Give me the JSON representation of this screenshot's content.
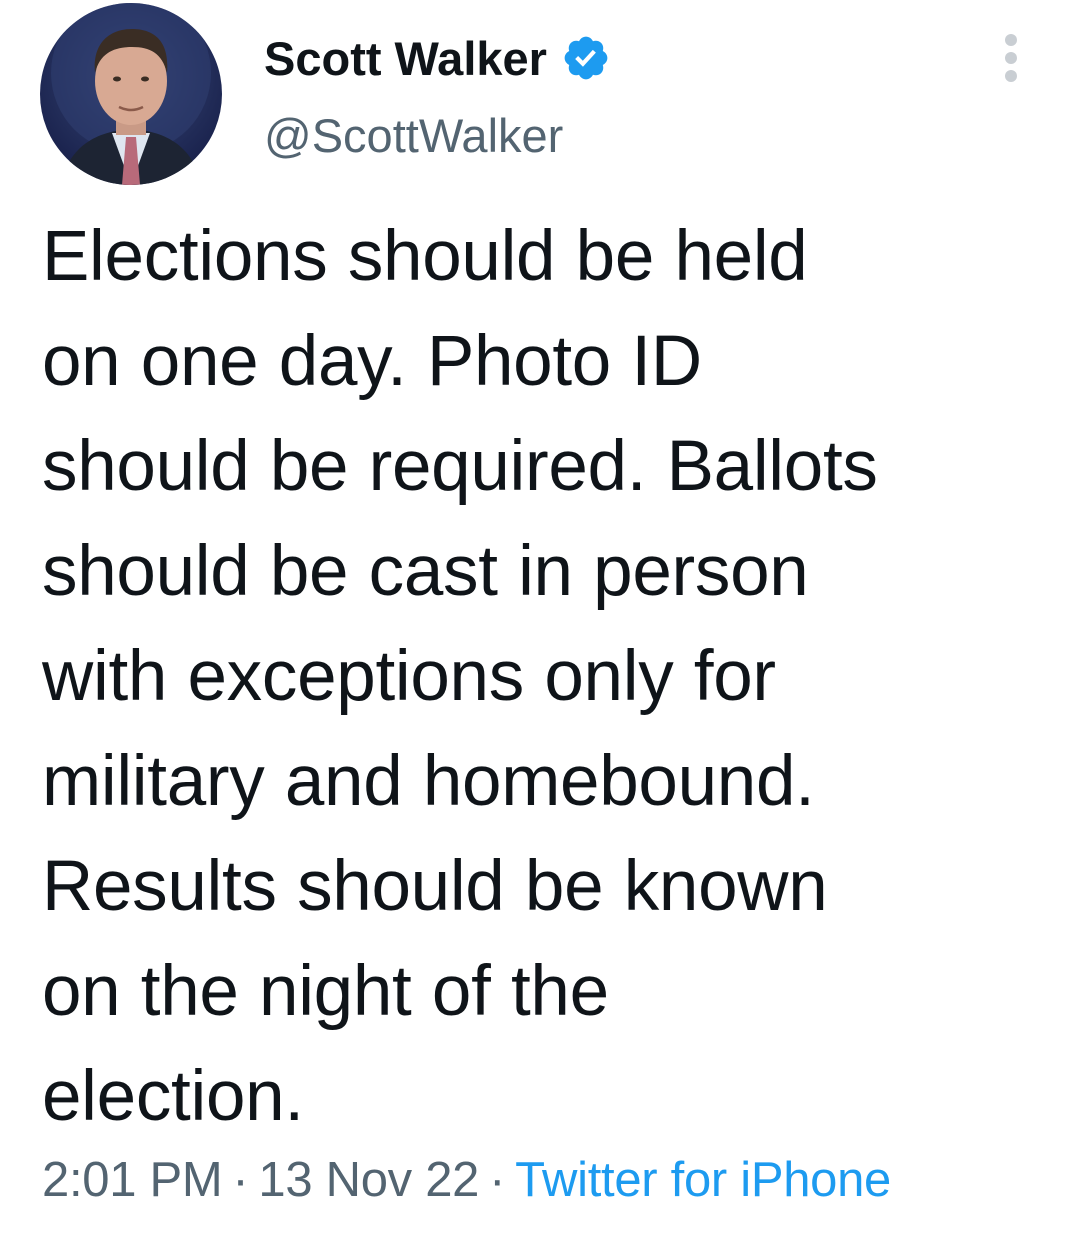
{
  "author": {
    "display_name": "Scott Walker",
    "handle": "@ScottWalker",
    "verified": true,
    "verified_icon": "verified-badge-icon",
    "avatar_icon": "profile-photo"
  },
  "tweet": {
    "lines": [
      "Elections should be held",
      "on one day. Photo ID",
      "should be required. Ballots",
      "should be cast in person",
      "with exceptions only for",
      "military and homebound.",
      "Results should be known",
      "on the night of the",
      "election."
    ]
  },
  "meta": {
    "time": "2:01 PM",
    "separator": "·",
    "date": "13 Nov 22",
    "source": "Twitter for iPhone"
  },
  "colors": {
    "text": "#0f1419",
    "secondary": "#536471",
    "link": "#1d9bf0",
    "verified": "#1d9bf0"
  }
}
